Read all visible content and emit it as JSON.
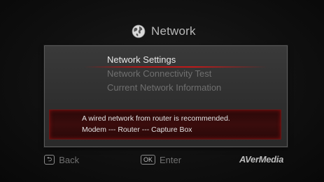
{
  "header": {
    "title": "Network",
    "icon": "globe-icon"
  },
  "menu": {
    "items": [
      {
        "label": "Network Settings",
        "active": true
      },
      {
        "label": "Network Connectivity Test",
        "active": false
      },
      {
        "label": "Current Network Information",
        "active": false
      }
    ]
  },
  "info": {
    "line1": "A wired network from router is recommended.",
    "line2": "Modem --- Router --- Capture Box"
  },
  "footer": {
    "back_key": "⮌",
    "back_label": "Back",
    "enter_key": "OK",
    "enter_label": "Enter",
    "brand": "AVerMedia"
  },
  "colors": {
    "accent": "#c01a1a",
    "panel": "#333333",
    "active_text": "#e8e8e8",
    "inactive_text": "#6f6f6f"
  }
}
